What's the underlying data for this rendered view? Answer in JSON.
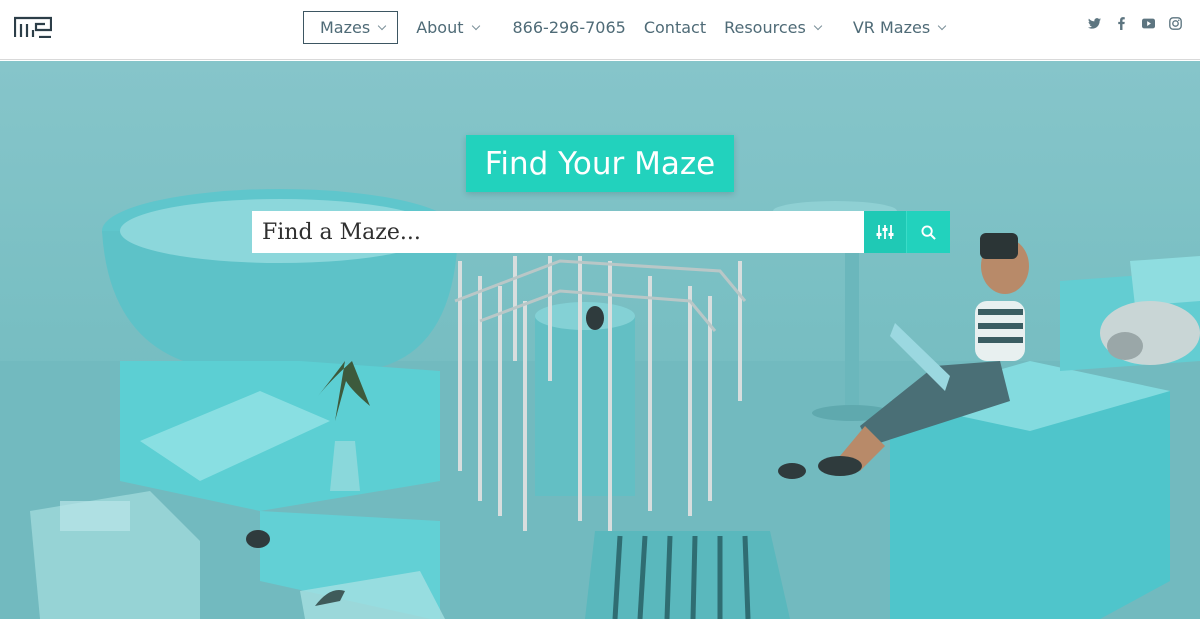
{
  "header": {
    "logo_icon": "maze-logo-icon",
    "nav": [
      {
        "label": "Mazes",
        "dropdown": true,
        "active": true
      },
      {
        "label": "About",
        "dropdown": true
      },
      {
        "label": "866-296-7065",
        "dropdown": false
      },
      {
        "label": "Contact",
        "dropdown": false
      },
      {
        "label": "Resources",
        "dropdown": true
      },
      {
        "label": "VR Mazes",
        "dropdown": true
      }
    ],
    "social_icons": [
      "twitter-icon",
      "facebook-icon",
      "youtube-icon",
      "instagram-icon"
    ]
  },
  "hero": {
    "title": "Find Your Maze",
    "search": {
      "placeholder": "Find a Maze...",
      "value": ""
    },
    "filter_icon": "sliders-icon",
    "search_icon": "search-icon"
  },
  "colors": {
    "accent": "#22d2bd",
    "nav_text": "#4f6b77",
    "hero_bg": "#79bfc3"
  }
}
